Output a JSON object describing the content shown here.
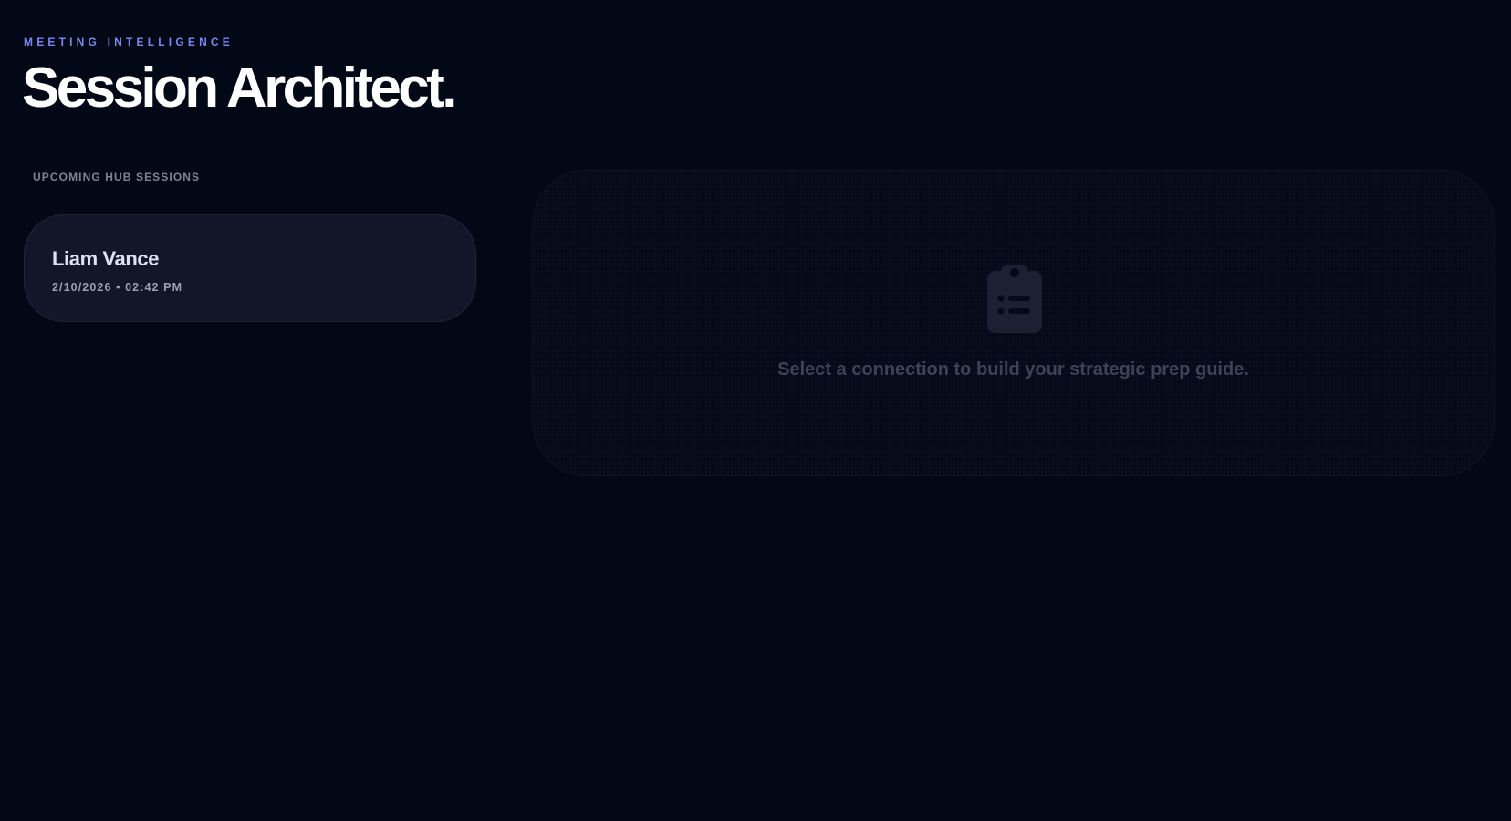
{
  "header": {
    "eyebrow": "MEETING INTELLIGENCE",
    "title": "Session Architect."
  },
  "sessions": {
    "label": "UPCOMING HUB SESSIONS",
    "items": [
      {
        "name": "Liam Vance",
        "meta": "2/10/2026 • 02:42 PM"
      }
    ]
  },
  "detail": {
    "icon": "clipboard-list-icon",
    "empty_message": "Select a connection to build your strategic prep guide."
  },
  "colors": {
    "background": "#030817",
    "accent": "#7b87f0",
    "card": "#111729"
  }
}
